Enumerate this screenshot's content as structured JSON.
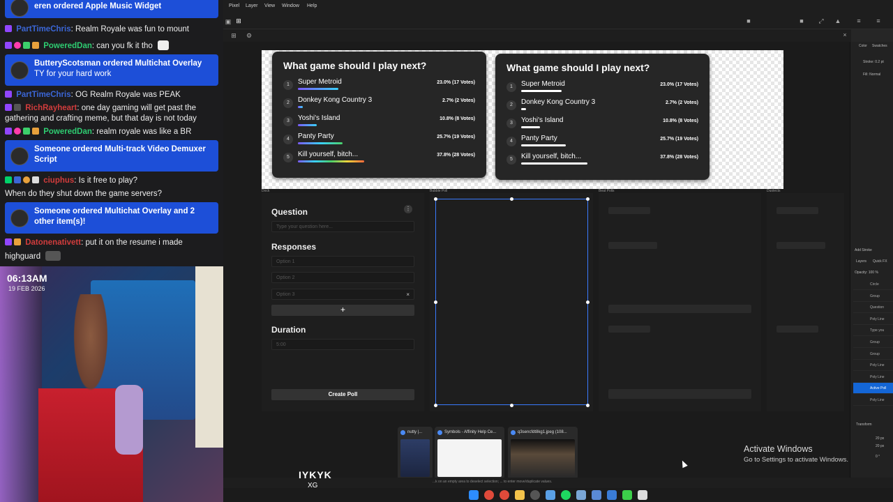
{
  "chat": {
    "messages": [
      {
        "type": "redeem",
        "title": "eren ordered Apple Music Widget",
        "sub": ""
      },
      {
        "type": "msg",
        "user": "PartTimeChris",
        "color": "#3b66d6",
        "text": ": Realm Royale was fun to mount"
      },
      {
        "type": "msg",
        "user": "PoweredDan",
        "color": "#2ecc71",
        "text": ": can you fk it tho"
      },
      {
        "type": "redeem",
        "title": "ButteryScotsman ordered Multichat Overlay",
        "sub": "TY for your hard work"
      },
      {
        "type": "msg",
        "user": "PartTimeChris",
        "color": "#3b66d6",
        "text": ": OG Realm Royale was PEAK"
      },
      {
        "type": "msg",
        "user": "RichRayheart",
        "color": "#d13c3c",
        "text": ": one day gaming will get past the",
        "cont": "gathering and crafting meme, but that day is not today"
      },
      {
        "type": "msg",
        "user": "PoweredDan",
        "color": "#2ecc71",
        "text": ": realm royale was like a BR"
      },
      {
        "type": "redeem",
        "title": "Someone ordered Multi-track Video Demuxer",
        "sub": "Script",
        "subBold": true
      },
      {
        "type": "msg",
        "user": "ciuphus",
        "color": "#d13c3c",
        "text": ": Is it free to play?",
        "cont": "When do they shut down the game servers?"
      },
      {
        "type": "redeem",
        "title": "Someone ordered Multichat Overlay and 2",
        "sub": "other item(s)!",
        "subBold": true
      },
      {
        "type": "msg",
        "user": "Datonenativett",
        "color": "#d13c3c",
        "text": ": put it on the resume i made",
        "cont": "highguard"
      }
    ]
  },
  "cam": {
    "time": "06:13AM",
    "date": "19 FEB 2026"
  },
  "menu": [
    "Pixel",
    "Layer",
    "View",
    "Window",
    "Help"
  ],
  "polls": [
    {
      "title": "What game should I play next?",
      "rows": [
        {
          "n": "1",
          "name": "Super Metroid",
          "pct": "23.0% (17 Votes)",
          "value": 23.0
        },
        {
          "n": "2",
          "name": "Donkey Kong Country 3",
          "pct": "2.7% (2 Votes)",
          "value": 2.7
        },
        {
          "n": "3",
          "name": "Yoshi's Island",
          "pct": "10.8% (8 Votes)",
          "value": 10.8
        },
        {
          "n": "4",
          "name": "Panty Party",
          "pct": "25.7% (19 Votes)",
          "value": 25.7
        },
        {
          "n": "5",
          "name": "Kill yourself, bitch...",
          "pct": "37.8% (28 Votes)",
          "value": 37.8
        }
      ]
    },
    {
      "title": "What game should I play next?",
      "rows": [
        {
          "n": "1",
          "name": "Super Metroid",
          "pct": "23.0% (17 Votes)",
          "value": 23.0
        },
        {
          "n": "2",
          "name": "Donkey Kong Country 3",
          "pct": "2.7% (2 Votes)",
          "value": 2.7
        },
        {
          "n": "3",
          "name": "Yoshi's Island",
          "pct": "10.8% (8 Votes)",
          "value": 10.8
        },
        {
          "n": "4",
          "name": "Panty Party",
          "pct": "25.7% (19 Votes)",
          "value": 25.7
        },
        {
          "n": "5",
          "name": "Kill yourself, bitch...",
          "pct": "37.8% (28 Votes)",
          "value": 37.8
        }
      ]
    }
  ],
  "artboards": {
    "labels": [
      "Dock",
      "Bubble Poll",
      "Beat Polls",
      "Duolects"
    ],
    "question": {
      "title": "Question",
      "placeholder": "Type your question here...",
      "responses_title": "Responses",
      "options": [
        "Option 1",
        "Option 2",
        "Option 3"
      ],
      "remove_glyph": "×",
      "add_glyph": "+",
      "duration_title": "Duration",
      "duration_placeholder": "5:00",
      "create_label": "Create Poll",
      "menu_glyph": "⋮"
    }
  },
  "rpanel": {
    "tabs": [
      "Color",
      "Swatches"
    ],
    "stroke": "Stroke: 0.2 pt",
    "fill": "Fill: Normal",
    "add_stroke": "Add Stroke",
    "layer_tabs": [
      "Layers",
      "Quick FX"
    ],
    "opacity": "Opacity: 100 %",
    "layers": [
      "Circle",
      "Group",
      "Question",
      "Poly Line",
      "Type you",
      "Group",
      "Group",
      "Poly Line",
      "Poly Line",
      "Active Poll",
      "Poly Line"
    ],
    "transform": "Transform",
    "coords": [
      "20 px",
      "20 px",
      "0 °"
    ]
  },
  "thumbs": [
    {
      "label": "nutty |..."
    },
    {
      "label": "Symbols - Affinity Help Ce..."
    },
    {
      "label": "q3sencfdt8kg1.jpeg (108..."
    }
  ],
  "status": "...k on an empty area to deselect selection; ... to enter move/duplicate values.",
  "activate": {
    "title": "Activate Windows",
    "sub": "Go to Settings to activate Windows."
  },
  "logo": {
    "main": "IYKYK",
    "sub": "XG"
  },
  "colors": {
    "accent": "#1466d6",
    "redeem": "#1d4fd8",
    "selection": "#3a7bff"
  }
}
